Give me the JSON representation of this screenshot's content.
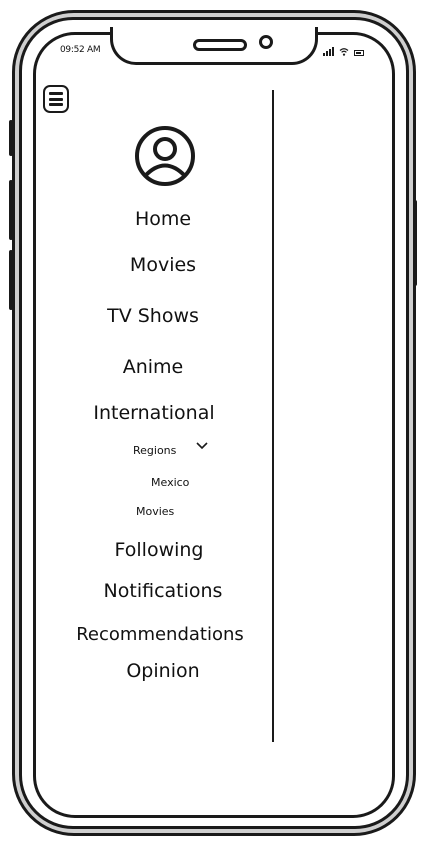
{
  "status_bar": {
    "time": "09:52 AM",
    "icons": [
      "signal-icon",
      "wifi-icon",
      "battery-icon"
    ]
  },
  "header": {
    "menu_icon": "hamburger-menu-icon",
    "avatar_icon": "user-avatar-icon"
  },
  "menu": {
    "home": "Home",
    "movies": "Movies",
    "tv_shows": "TV Shows",
    "anime": "Anime",
    "international": "International",
    "regions": "Regions",
    "regions_icon": "chevron-down-icon",
    "mexico": "Mexico",
    "mexico_movies": "Movies",
    "following": "Following",
    "notifications": "Notifications",
    "recommendations": "Recommendations",
    "opinion": "Opinion"
  }
}
